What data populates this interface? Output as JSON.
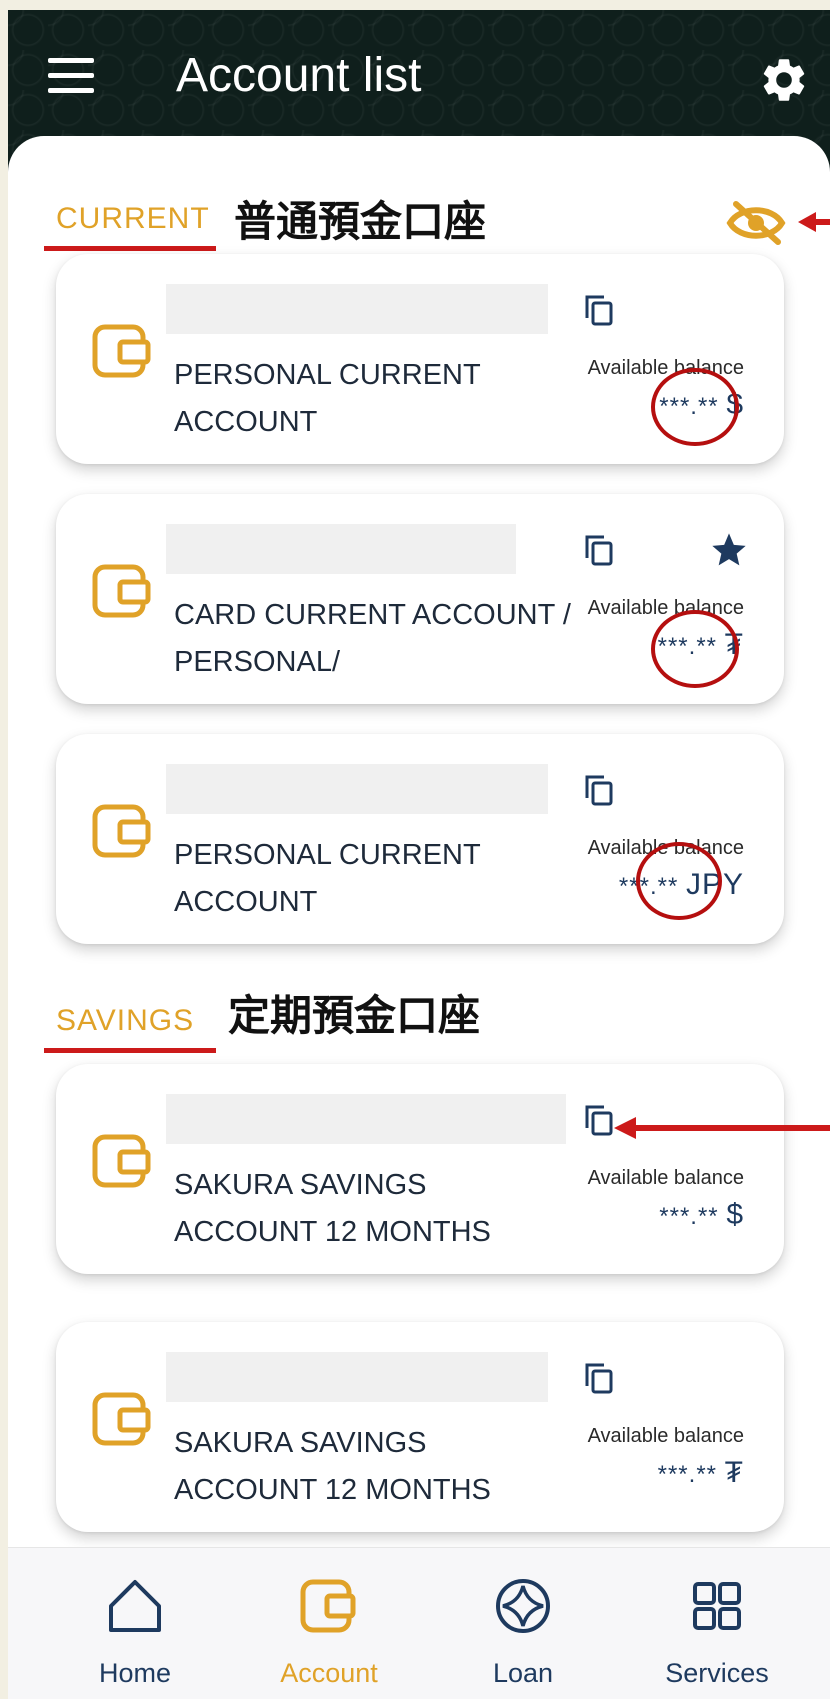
{
  "header": {
    "title": "Account list",
    "menu_icon": "hamburger-menu-icon",
    "settings_icon": "gear-icon"
  },
  "sections": {
    "current": {
      "label": "CURRENT",
      "annotation": "普通預金口座"
    },
    "savings": {
      "label": "SAVINGS",
      "annotation": "定期預金口座"
    }
  },
  "accounts": [
    {
      "name": "PERSONAL CURRENT ACCOUNT",
      "balance_label": "Available balance",
      "balance": "***.**",
      "currency": "$",
      "favorite": false
    },
    {
      "name": "CARD CURRENT ACCOUNT / PERSONAL/",
      "balance_label": "Available balance",
      "balance": "***.**",
      "currency": "₮",
      "favorite": true
    },
    {
      "name": "PERSONAL CURRENT ACCOUNT",
      "balance_label": "Available balance",
      "balance": "***.**",
      "currency": "JPY",
      "favorite": false
    },
    {
      "name": "SAKURA SAVINGS ACCOUNT 12 MONTHS",
      "balance_label": "Available balance",
      "balance": "***.**",
      "currency": "$",
      "favorite": false
    },
    {
      "name": "SAKURA SAVINGS ACCOUNT 12 MONTHS",
      "balance_label": "Available balance",
      "balance": "***.**",
      "currency": "₮",
      "favorite": false
    }
  ],
  "nav": [
    {
      "label": "Home",
      "icon": "home-icon",
      "active": false
    },
    {
      "label": "Account",
      "icon": "wallet-icon",
      "active": true
    },
    {
      "label": "Loan",
      "icon": "loan-icon",
      "active": false
    },
    {
      "label": "Services",
      "icon": "grid-icon",
      "active": false
    }
  ],
  "colors": {
    "accent": "#e0a228",
    "header_bg": "#0f1f1c",
    "annotation_red": "#b50f0f",
    "text_navy": "#1e3a5f"
  }
}
